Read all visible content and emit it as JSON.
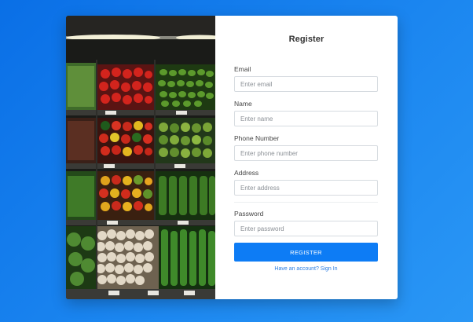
{
  "colors": {
    "background_start": "#0a6fe6",
    "background_end": "#2a97f5",
    "button": "#0d7cf5",
    "link": "#2a7de1"
  },
  "image": {
    "description_icon": "vegetable-market-photo"
  },
  "form": {
    "title": "Register",
    "fields": [
      {
        "label": "Email",
        "placeholder": "Enter email",
        "value": ""
      },
      {
        "label": "Name",
        "placeholder": "Enter name",
        "value": ""
      },
      {
        "label": "Phone Number",
        "placeholder": "Enter phone number",
        "value": ""
      },
      {
        "label": "Address",
        "placeholder": "Enter address",
        "value": ""
      },
      {
        "label": "Password",
        "placeholder": "Enter password",
        "value": ""
      }
    ],
    "submit_label": "REGISTER",
    "signin_link": "Have an account? Sign In"
  }
}
